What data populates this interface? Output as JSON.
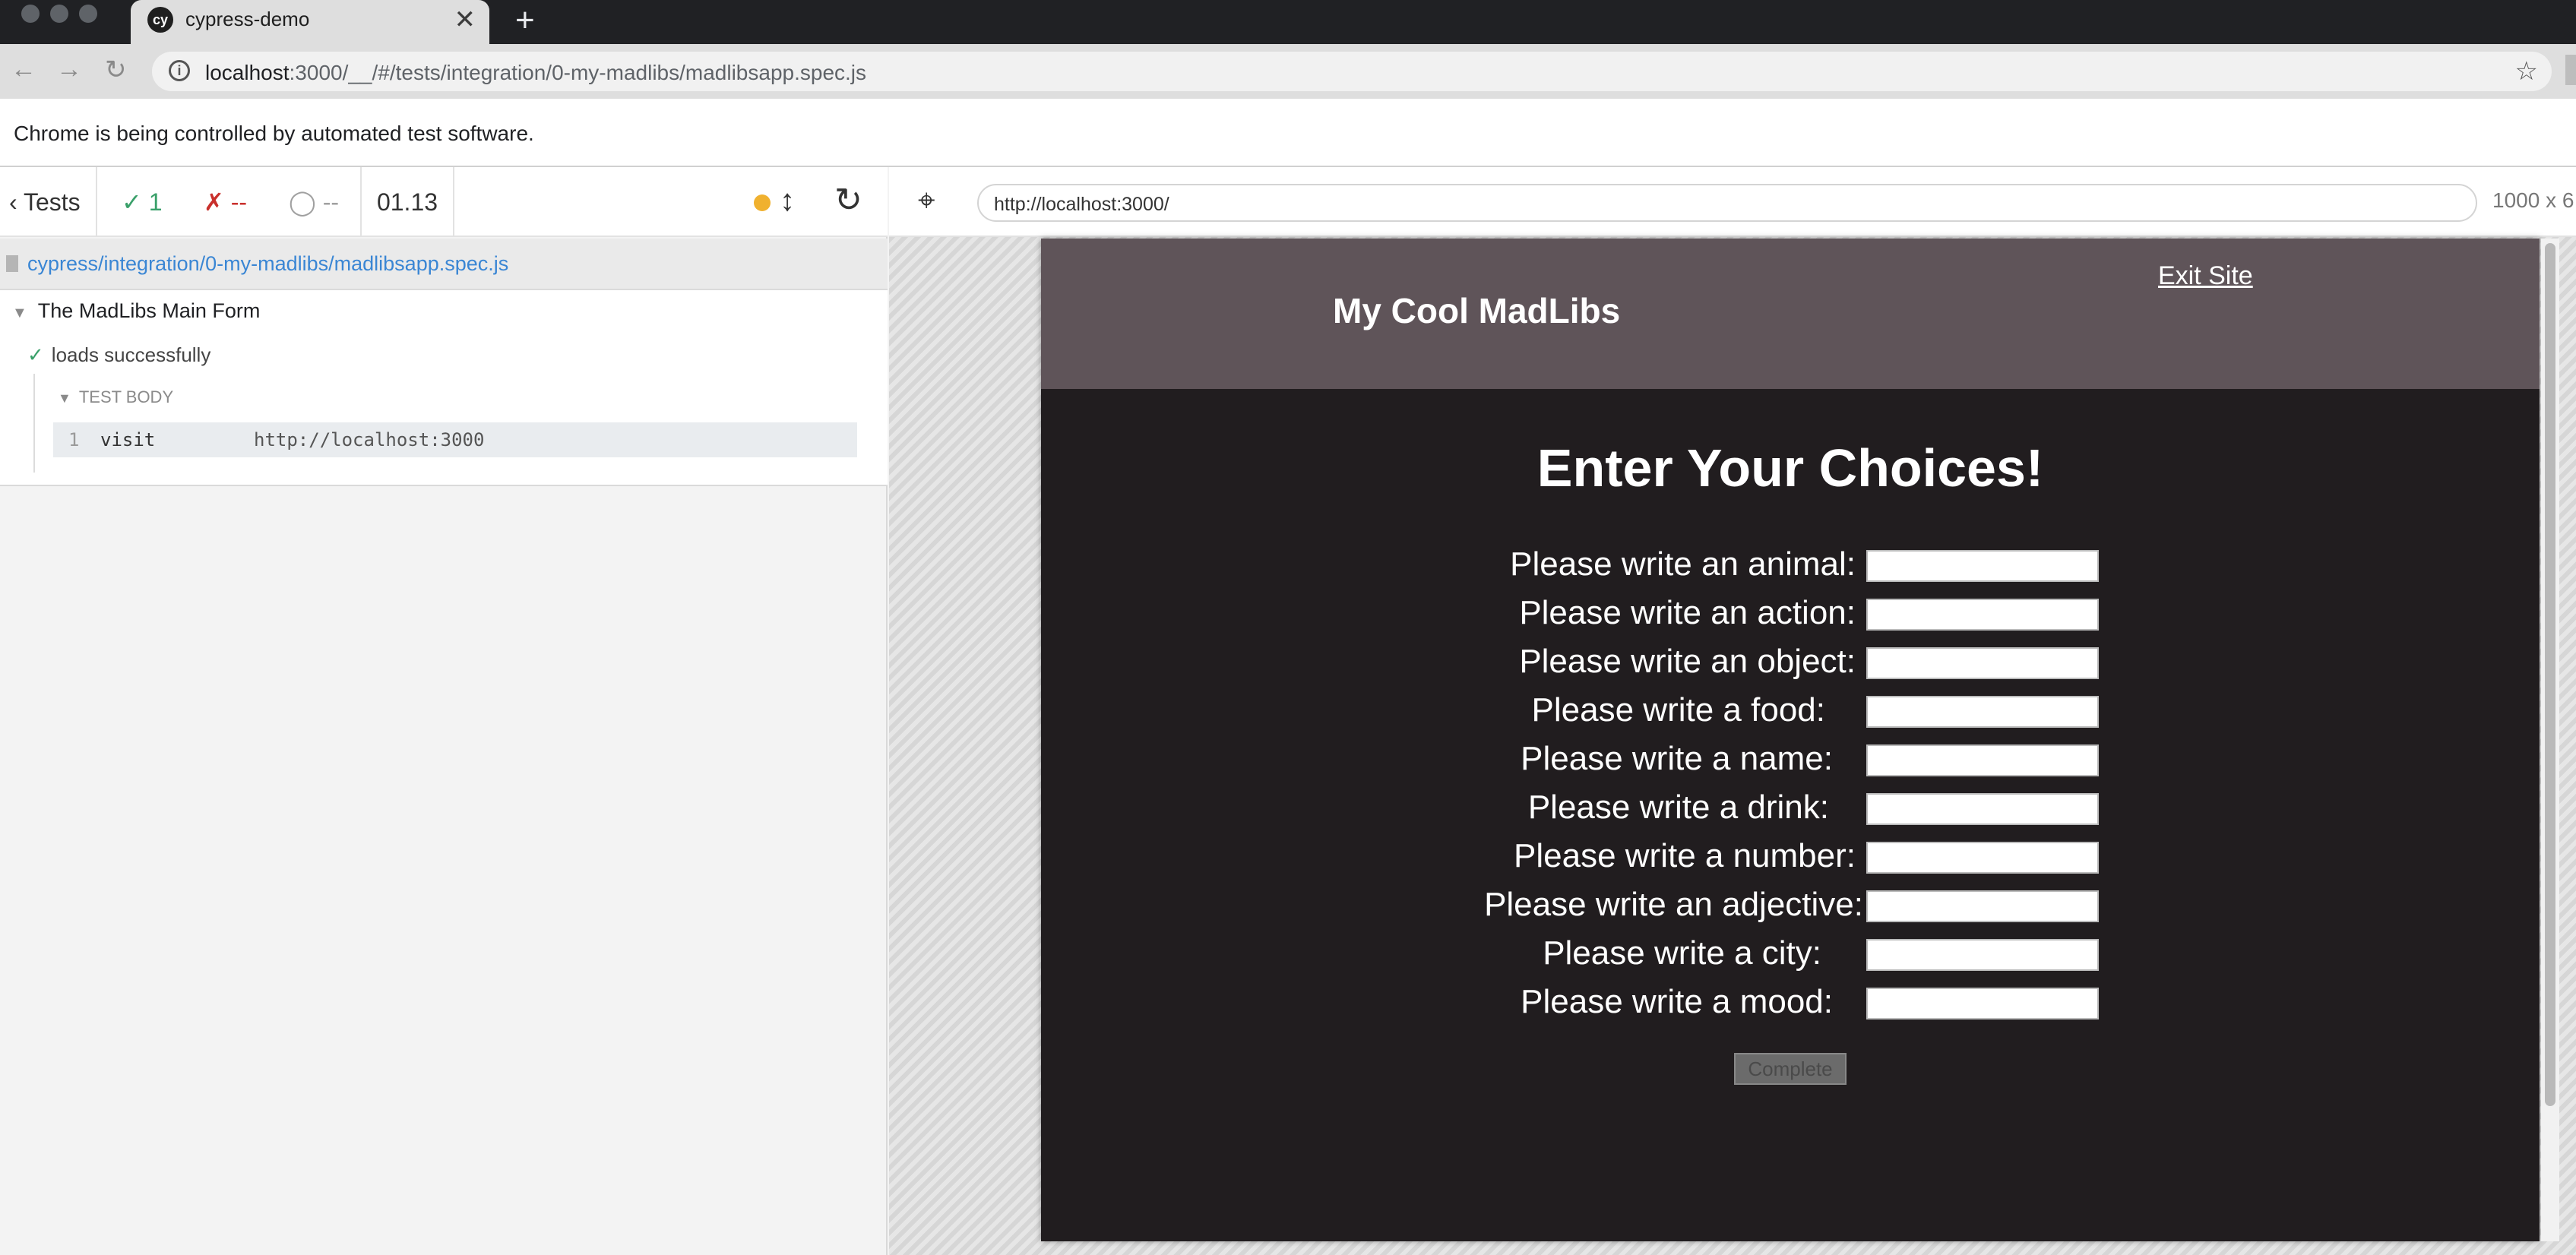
{
  "browser": {
    "tab_title": "cypress-demo",
    "tab_icon": "cy",
    "close_glyph": "✕",
    "newtab_glyph": "+",
    "back_glyph": "←",
    "forward_glyph": "→",
    "reload_glyph": "↻",
    "info_glyph": "i",
    "star_glyph": "☆",
    "url_host": "localhost",
    "url_rest": ":3000/__/#/tests/integration/0-my-madlibs/madlibsapp.spec.js",
    "infobar_text": "Chrome is being controlled by automated test software."
  },
  "reporter": {
    "tests_label": "Tests",
    "back_glyph": "‹",
    "passed_glyph": "✓",
    "passed": "1",
    "failed_glyph": "✗",
    "failed": "--",
    "pending_glyph": "◯",
    "pending": "--",
    "duration": "01.13",
    "resize_glyph": "↕",
    "rerun_glyph": "↻",
    "spec_path": "cypress/integration/0-my-madlibs/madlibsapp.spec.js",
    "suite_title": "The MadLibs Main Form",
    "test_title": "loads successfully",
    "check_glyph": "✓",
    "caret_glyph": "▼",
    "body_header": "TEST BODY",
    "commands": [
      {
        "num": "1",
        "name": "visit",
        "message": "http://localhost:3000"
      }
    ]
  },
  "aut": {
    "selector_glyph": "⌖",
    "url": "http://localhost:3000/",
    "viewport": "1000 x 6"
  },
  "app": {
    "title": "My Cool MadLibs",
    "exit_link": "Exit Site",
    "heading": "Enter Your Choices!",
    "fields": [
      {
        "label": "Please write an animal:",
        "value": ""
      },
      {
        "label": "Please write an action:",
        "value": ""
      },
      {
        "label": "Please write an object:",
        "value": ""
      },
      {
        "label": "Please write a food:",
        "value": ""
      },
      {
        "label": "Please write a name:",
        "value": ""
      },
      {
        "label": "Please write a drink:",
        "value": ""
      },
      {
        "label": "Please write a number:",
        "value": ""
      },
      {
        "label": "Please write an adjective:",
        "value": ""
      },
      {
        "label": "Please write a city:",
        "value": ""
      },
      {
        "label": "Please write a mood:",
        "value": ""
      }
    ],
    "submit_label": "Complete"
  },
  "colors": {
    "passed": "#3aa06a",
    "failed": "#c9302c",
    "running_dot": "#f0b12f",
    "app_header": "#5f5459",
    "app_body": "#211d1f",
    "link": "#3a86d4"
  }
}
